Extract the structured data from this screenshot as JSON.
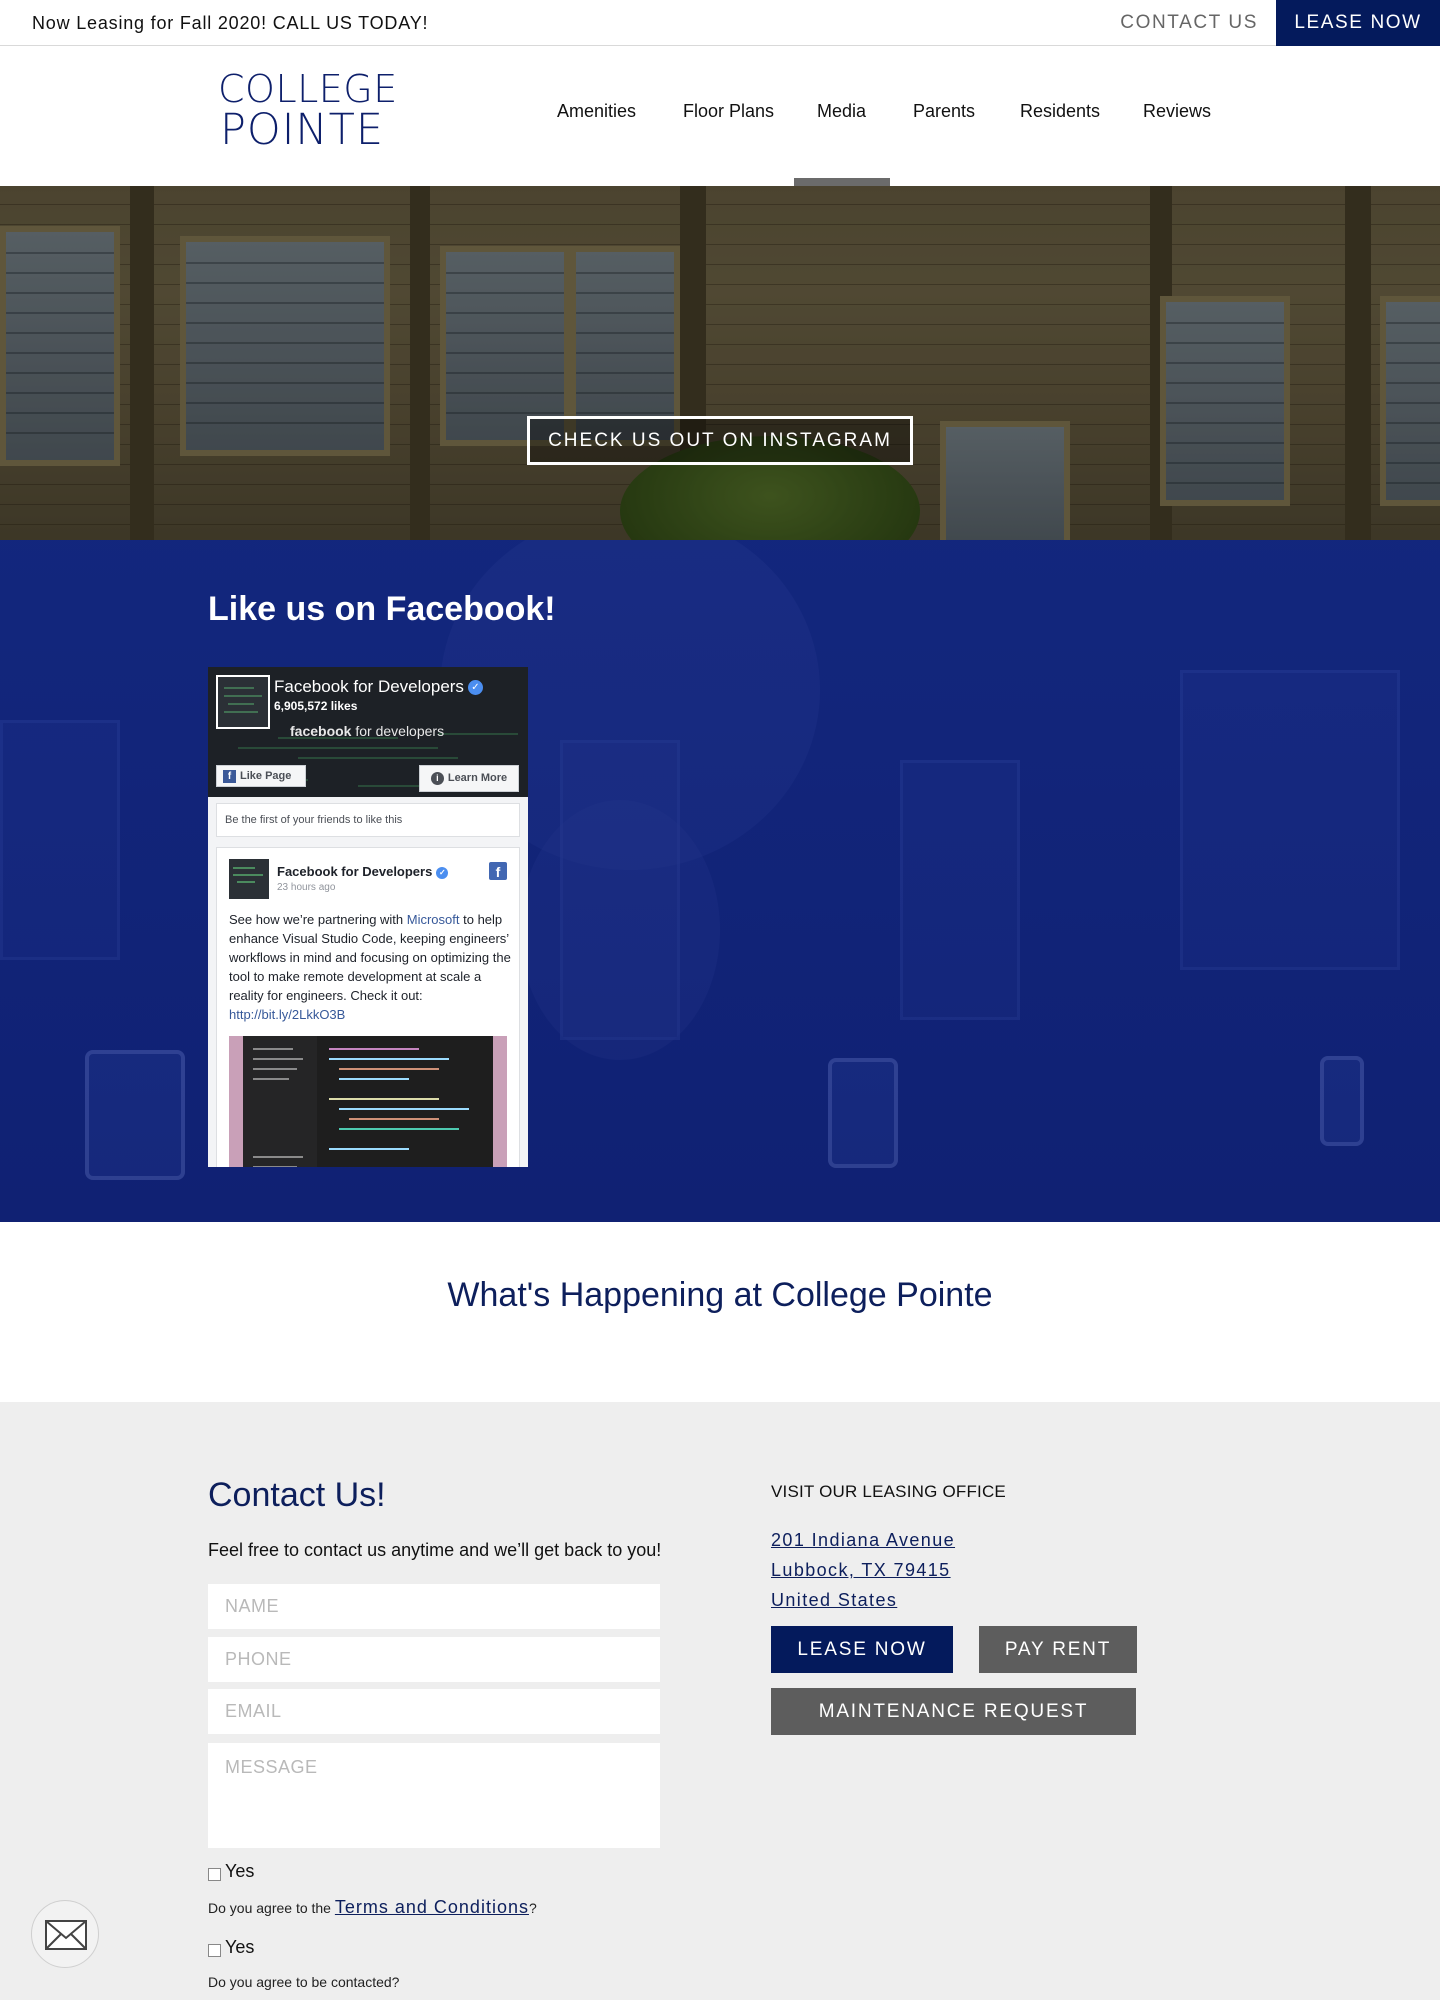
{
  "topbar": {
    "promo": "Now Leasing for Fall 2020! CALL US TODAY!",
    "contact": "CONTACT US",
    "lease": "LEASE NOW"
  },
  "logo": {
    "line1": "COLLEGE",
    "line2": "POINTE"
  },
  "nav": {
    "items": [
      "Amenities",
      "Floor Plans",
      "Media",
      "Parents",
      "Residents",
      "Reviews"
    ],
    "active": "Media"
  },
  "hero": {
    "button": "CHECK US OUT ON INSTAGRAM"
  },
  "facebook": {
    "heading": "Like us on Facebook!",
    "widget": {
      "page_name": "Facebook for Developers",
      "likes": "6,905,572 likes",
      "brand_bold": "facebook",
      "brand_rest": " for developers",
      "like_button": "Like Page",
      "learn_button": "Learn More",
      "friends_text": "Be the first of your friends to like this",
      "post_author": "Facebook for Developers",
      "post_time": "23 hours ago",
      "post_text_1": "See how we’re partnering with ",
      "post_link_1": "Microsoft",
      "post_text_2": " to help enhance Visual Studio Code, keeping engineers’ workflows in mind and focusing on optimizing the tool to make remote development at scale a reality for engineers. Check it out: ",
      "post_link_2": "http://bit.ly/2LkkO3B"
    }
  },
  "happening": {
    "title": "What's Happening at College Pointe"
  },
  "contact": {
    "title": "Contact Us!",
    "intro": "Feel free to contact us anytime and we’ll get back to you!",
    "placeholders": {
      "name": "NAME",
      "phone": "PHONE",
      "email": "EMAIL",
      "message": "MESSAGE"
    },
    "checkbox1_label": "Yes",
    "terms_prefix": "Do you agree to the ",
    "terms_link": "Terms and Conditions",
    "terms_suffix": "?",
    "checkbox2_label": "Yes",
    "contact_question": "Do you agree to be contacted?"
  },
  "office": {
    "title": "VISIT OUR LEASING OFFICE",
    "address_line1": "201 Indiana Avenue",
    "address_line2": "Lubbock, TX 79415",
    "address_line3": "United States",
    "lease_button": "LEASE NOW",
    "pay_button": "PAY RENT",
    "maintenance_button": "MAINTENANCE REQUEST"
  },
  "colors": {
    "navy": "#041a5c",
    "heading_navy": "#0d1f5c",
    "gray_button": "#5d5d5d",
    "contact_bg": "#eeeeee"
  },
  "icons": {
    "mail_fab": "mail-icon",
    "verified": "check-icon",
    "facebook": "facebook-icon",
    "info": "info-icon"
  }
}
